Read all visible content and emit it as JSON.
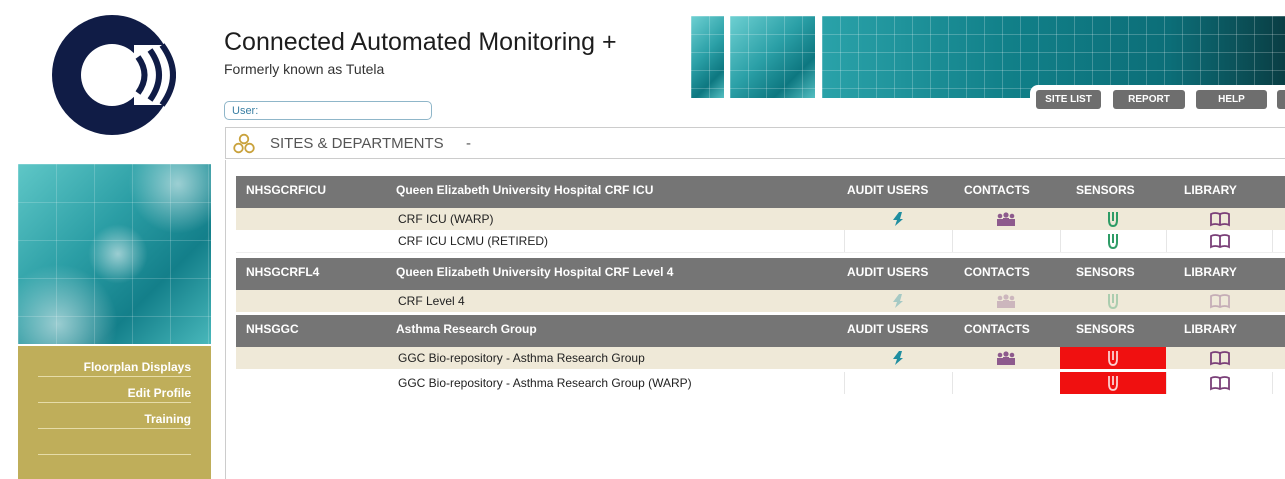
{
  "header": {
    "title": "Connected Automated Monitoring +",
    "subtitle": "Formerly known as Tutela",
    "user_label": "User:"
  },
  "nav": {
    "buttons": [
      "SITE LIST",
      "REPORT",
      "HELP"
    ]
  },
  "side_menu": {
    "items": [
      "Floorplan Displays",
      "Edit Profile",
      "Training"
    ]
  },
  "sites_bar": {
    "label": "SITES & DEPARTMENTS",
    "caret": "-"
  },
  "columns": [
    "AUDIT USERS",
    "CONTACTS",
    "SENSORS",
    "LIBRARY"
  ],
  "groups": [
    {
      "code": "NHSGCRFICU",
      "name": "Queen Elizabeth University Hospital CRF ICU",
      "sites": [
        {
          "name": "CRF ICU (WARP)",
          "audit": true,
          "contacts": true,
          "sensor_alarm": false,
          "faded": false
        },
        {
          "name": "CRF ICU LCMU (RETIRED)",
          "audit": false,
          "contacts": false,
          "sensor_alarm": false,
          "faded": false
        }
      ]
    },
    {
      "code": "NHSGCRFL4",
      "name": "Queen Elizabeth University Hospital CRF Level 4",
      "sites": [
        {
          "name": "CRF Level 4",
          "audit": true,
          "contacts": true,
          "sensor_alarm": false,
          "faded": true
        }
      ]
    },
    {
      "code": "NHSGGC",
      "name": "Asthma Research Group",
      "sites": [
        {
          "name": "GGC Bio-repository - Asthma Research Group",
          "audit": true,
          "contacts": true,
          "sensor_alarm": true,
          "faded": false
        },
        {
          "name": "GGC Bio-repository - Asthma Research Group (WARP)",
          "audit": false,
          "contacts": false,
          "sensor_alarm": true,
          "faded": false
        }
      ]
    }
  ],
  "colors": {
    "header_grey": "#757575",
    "row_beige": "#efe9d8",
    "alarm_red": "#f01010",
    "audit_teal": "#1f8ea0",
    "contacts_purple": "#8d5a8d",
    "sensor_green": "#2e9c66",
    "library_purple": "#7a3f78",
    "logo_navy": "#101c46",
    "menu_gold": "#bfae5a"
  },
  "icons": {
    "audit": "audit-user-icon",
    "contacts": "contacts-group-icon",
    "sensors": "sensor-probe-icon",
    "library": "library-book-icon"
  }
}
